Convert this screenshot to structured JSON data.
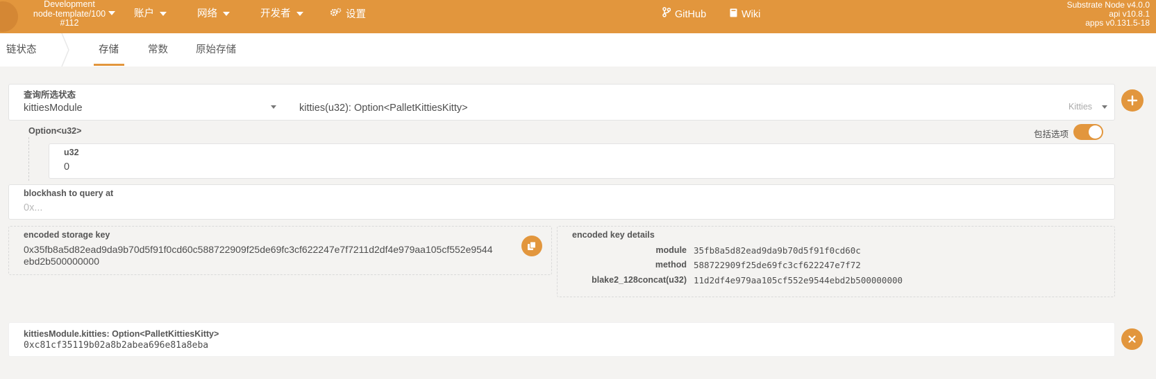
{
  "header": {
    "chain_line1": "Development",
    "chain_line2": "node-template/100",
    "chain_line3": "#112",
    "menu": [
      {
        "label": "账户",
        "icon": "chevron-down-icon"
      },
      {
        "label": "网络",
        "icon": "chevron-down-icon"
      },
      {
        "label": "开发者",
        "icon": "chevron-down-icon"
      },
      {
        "label": "设置",
        "icon": "gears-icon"
      }
    ],
    "links": [
      {
        "label": "GitHub",
        "icon": "code-branch-icon"
      },
      {
        "label": "Wiki",
        "icon": "book-icon"
      }
    ],
    "version": {
      "node": "Substrate Node v4.0.0",
      "api": "api v10.8.1",
      "apps": "apps v0.131.5-18"
    }
  },
  "subnav": {
    "section": "链状态",
    "tabs": [
      "存储",
      "常数",
      "原始存储"
    ],
    "active_tab": "存储"
  },
  "query": {
    "label": "查询所选状态",
    "module": "kittiesModule",
    "method": "kitties(u32): Option<PalletKittiesKitty>",
    "method_hint": "Kitties",
    "option_label": "Option<u32>",
    "include_option_label": "包括选项",
    "include_option": true,
    "param_label": "u32",
    "param_value": "0"
  },
  "blockhash": {
    "label": "blockhash to query at",
    "placeholder": "0x..."
  },
  "encoded": {
    "label": "encoded storage key",
    "line1": "0x35fb8a5d82ead9da9b70d5f91f0cd60c588722909f25de69fc3cf622247e7f7211d2df4e979aa105cf552e9544",
    "line2": "ebd2b500000000",
    "copy_icon": "copy-icon"
  },
  "key_details": {
    "label": "encoded key details",
    "rows": [
      {
        "key": "module",
        "value": "35fb8a5d82ead9da9b70d5f91f0cd60c"
      },
      {
        "key": "method",
        "value": "588722909f25de69fc3cf622247e7f72"
      },
      {
        "key": "blake2_128concat(u32)",
        "value": "11d2df4e979aa105cf552e9544ebd2b500000000"
      }
    ]
  },
  "result": {
    "label": "kittiesModule.kitties: Option<PalletKittiesKitty>",
    "value": "0xc81cf35119b02a8b2abea696e81a8eba"
  },
  "colors": {
    "accent": "#e2963d"
  }
}
